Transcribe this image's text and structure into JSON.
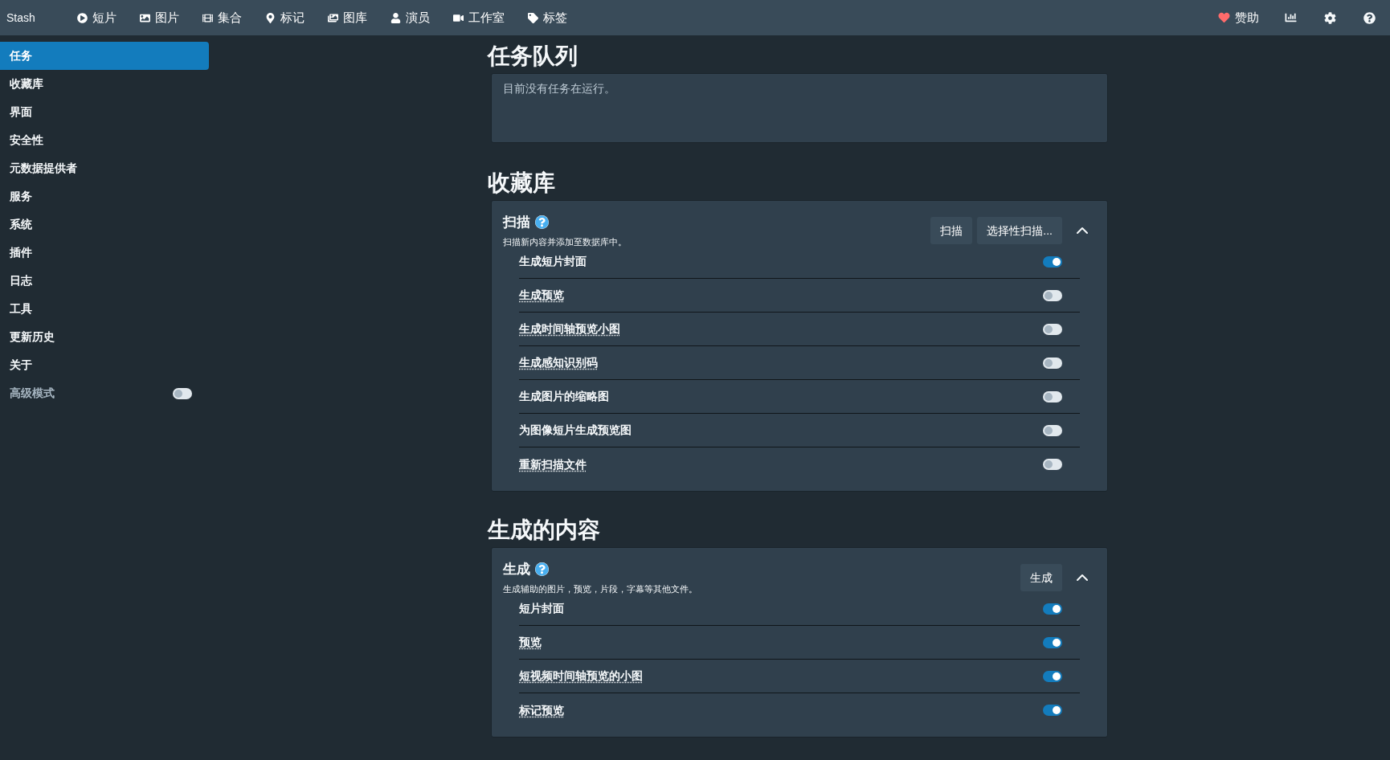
{
  "nav": {
    "brand": "Stash",
    "items": [
      "短片",
      "图片",
      "集合",
      "标记",
      "图库",
      "演员",
      "工作室",
      "标签"
    ],
    "donate": "赞助"
  },
  "sidebar": {
    "items": [
      {
        "label": "任务",
        "selected": true
      },
      {
        "label": "收藏库",
        "selected": false
      },
      {
        "label": "界面",
        "selected": false
      },
      {
        "label": "安全性",
        "selected": false
      },
      {
        "label": "元数据提供者",
        "selected": false
      },
      {
        "label": "服务",
        "selected": false
      },
      {
        "label": "系统",
        "selected": false
      },
      {
        "label": "插件",
        "selected": false
      },
      {
        "label": "日志",
        "selected": false
      },
      {
        "label": "工具",
        "selected": false
      },
      {
        "label": "更新历史",
        "selected": false
      },
      {
        "label": "关于",
        "selected": false
      }
    ],
    "advanced": {
      "label": "高级模式",
      "on": false
    }
  },
  "queue": {
    "heading": "任务队列",
    "message": "目前没有任务在运行。"
  },
  "sections": [
    {
      "heading": "收藏库",
      "title": "扫描",
      "description": "扫描新内容并添加至数据库中。",
      "buttons": [
        "扫描",
        "选择性扫描..."
      ],
      "expanded": true,
      "options": [
        {
          "label": "生成短片封面",
          "on": true,
          "tooltip": false
        },
        {
          "label": "生成预览",
          "on": false,
          "tooltip": true
        },
        {
          "label": "生成时间轴预览小图",
          "on": false,
          "tooltip": true
        },
        {
          "label": "生成感知识别码",
          "on": false,
          "tooltip": true
        },
        {
          "label": "生成图片的缩略图",
          "on": false,
          "tooltip": false
        },
        {
          "label": "为图像短片生成预览图",
          "on": false,
          "tooltip": false
        },
        {
          "label": "重新扫描文件",
          "on": false,
          "tooltip": true
        }
      ]
    },
    {
      "heading": "生成的内容",
      "title": "生成",
      "description": "生成辅助的图片，预览，片段，字幕等其他文件。",
      "buttons": [
        "生成"
      ],
      "expanded": true,
      "options": [
        {
          "label": "短片封面",
          "on": true,
          "tooltip": false
        },
        {
          "label": "预览",
          "on": true,
          "tooltip": true
        },
        {
          "label": "短视频时间轴预览的小图",
          "on": true,
          "tooltip": true
        },
        {
          "label": "标记预览",
          "on": true,
          "tooltip": true
        }
      ]
    }
  ]
}
